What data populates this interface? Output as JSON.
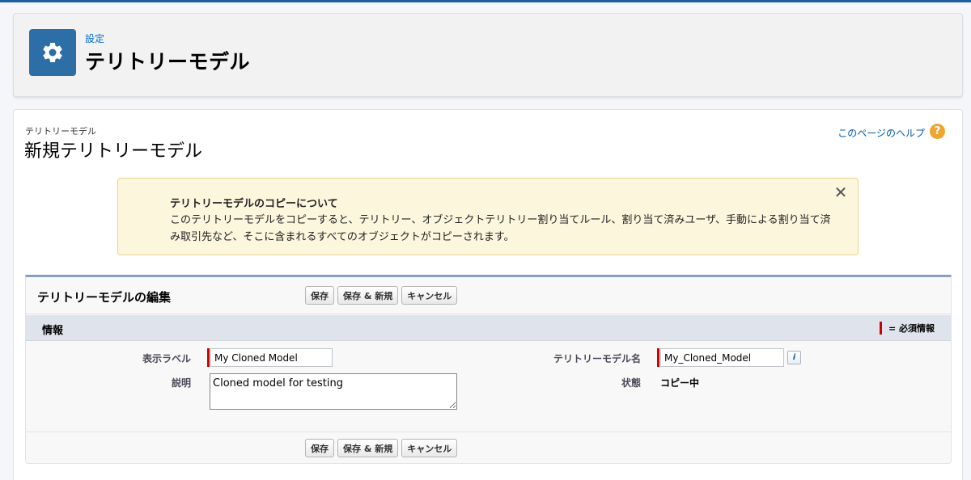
{
  "setup": {
    "breadcrumb": "設定",
    "title": "テリトリーモデル"
  },
  "page": {
    "subtitle": "テリトリーモデル",
    "title": "新規テリトリーモデル",
    "help_link": "このページのヘルプ",
    "help_icon": "?"
  },
  "banner": {
    "title": "テリトリーモデルのコピーについて",
    "body": "このテリトリーモデルをコピーすると、テリトリー、オブジェクトテリトリー割り当てルール、割り当て済みユーザ、手動による割り当て済み取引先など、そこに含まれるすべてのオブジェクトがコピーされます。",
    "close": "✕"
  },
  "edit": {
    "title": "テリトリーモデルの編集",
    "buttons": {
      "save": "保存",
      "save_new": "保存 & 新規",
      "cancel": "キャンセル"
    }
  },
  "section": {
    "title": "情報",
    "required_legend": "= 必須情報"
  },
  "fields": {
    "display_label": {
      "label": "表示ラベル",
      "value": "My Cloned Model"
    },
    "description": {
      "label": "説明",
      "value": "Cloned model for testing"
    },
    "model_name": {
      "label": "テリトリーモデル名",
      "value": "My_Cloned_Model",
      "info": "i"
    },
    "status": {
      "label": "状態",
      "value": "コピー中"
    }
  },
  "icons": {
    "setup": "gear-icon",
    "help": "question-icon",
    "close": "close-icon",
    "info": "info-icon"
  },
  "colors": {
    "setup_icon_bg": "#2e6ea6",
    "link": "#0070d2",
    "required": "#cc0000",
    "banner_bg": "#fcf6dd",
    "help_icon": "#f0a531"
  }
}
